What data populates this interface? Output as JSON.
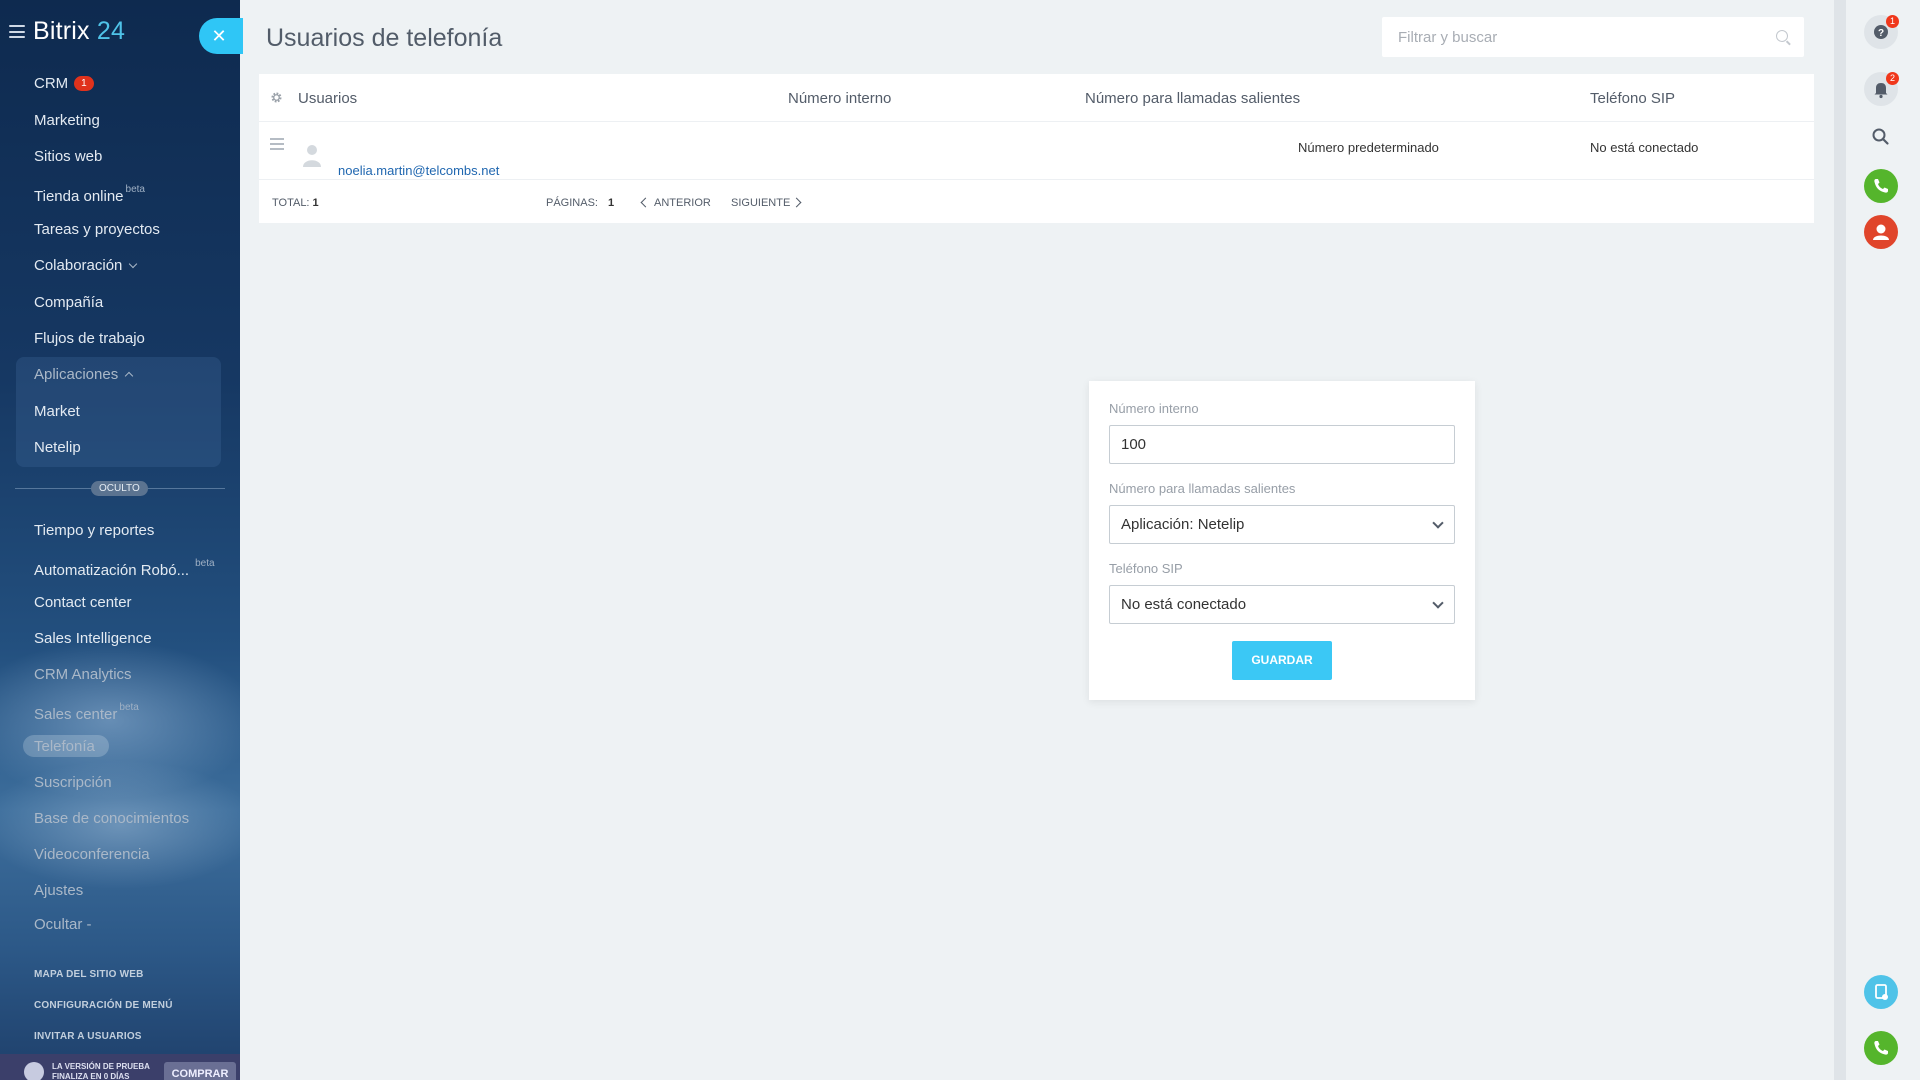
{
  "app": {
    "logo_main": "Bitrix",
    "logo_num": "24"
  },
  "sidebar": {
    "items": [
      {
        "label": "CRM",
        "badge": "1"
      },
      {
        "label": "Marketing"
      },
      {
        "label": "Sitios web"
      },
      {
        "label": "Tienda online",
        "tag": "beta"
      },
      {
        "label": "Tareas y proyectos"
      },
      {
        "label": "Colaboración"
      },
      {
        "label": "Compañía"
      },
      {
        "label": "Flujos de trabajo"
      },
      {
        "label": "Aplicaciones"
      },
      {
        "label": "Market"
      },
      {
        "label": "Netelip"
      }
    ],
    "hidden_label": "OCULTO",
    "hidden_items": [
      {
        "label": "Tiempo y reportes"
      },
      {
        "label": "Automatización Robó...",
        "tag": "beta"
      },
      {
        "label": "Contact center"
      },
      {
        "label": "Sales Intelligence"
      },
      {
        "label": "CRM Analytics"
      },
      {
        "label": "Sales center",
        "tag": "beta"
      },
      {
        "label": "Telefonía"
      },
      {
        "label": "Suscripción"
      },
      {
        "label": "Base de conocimientos"
      },
      {
        "label": "Videoconferencia"
      },
      {
        "label": "Ajustes"
      },
      {
        "label": "Ocultar -"
      }
    ],
    "links": [
      "MAPA DEL SITIO WEB",
      "CONFIGURACIÓN DE MENÚ",
      "INVITAR A USUARIOS"
    ],
    "trial_text": "LA VERSIÓN DE PRUEBA FINALIZA EN 0 DÍAS",
    "buy_label": "COMPRAR"
  },
  "page": {
    "title": "Usuarios de telefonía",
    "search_placeholder": "Filtrar y buscar"
  },
  "grid": {
    "columns": [
      "Usuarios",
      "Número interno",
      "Número para llamadas salientes",
      "Teléfono SIP"
    ],
    "rows": [
      {
        "user": "noelia.martin@telcombs.net",
        "internal": "",
        "outgoing": "Número predeterminado",
        "sip": "No está conectado"
      }
    ],
    "footer": {
      "total_label": "TOTAL:",
      "total": "1",
      "pages_label": "PÁGINAS:",
      "page": "1",
      "prev": "ANTERIOR",
      "next": "SIGUIENTE"
    }
  },
  "form": {
    "internal_label": "Número interno",
    "internal_value": "100",
    "outgoing_label": "Número para llamadas salientes",
    "outgoing_value": "Aplicación: Netelip",
    "sip_label": "Teléfono SIP",
    "sip_value": "No está conectado",
    "save_label": "GUARDAR"
  },
  "right_panel": {
    "help_badge": "1",
    "notifications_badge": "2",
    "colors": {
      "phone": "#55b52c",
      "user": "#e0452b",
      "chat": "#4fc3e8",
      "call": "#55b52c"
    }
  },
  "colors": {
    "accent": "#2fc6f6",
    "link": "#2067b0",
    "badge": "#e0321c"
  }
}
